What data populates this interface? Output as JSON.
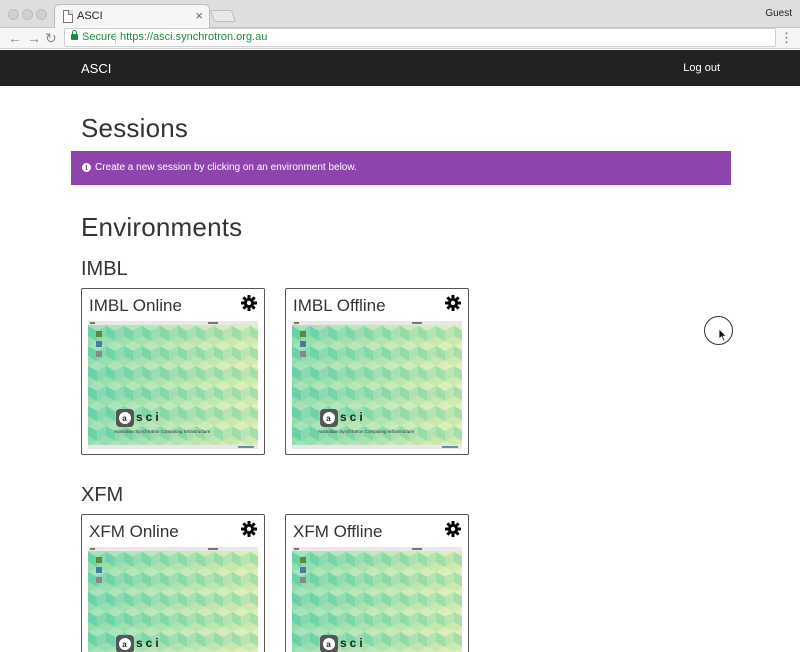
{
  "browser": {
    "tab_title": "ASCI",
    "tab_close": "×",
    "profile": "Guest",
    "back": "←",
    "forward": "→",
    "reload": "↻",
    "secure_label": "Secure",
    "url": "https://asci.synchrotron.org.au",
    "menu": "⋮"
  },
  "navbar": {
    "brand": "ASCI",
    "logout": "Log out"
  },
  "page": {
    "title": "Sessions",
    "alert": "Create a new session by clicking on an environment below.",
    "alert_icon": "i",
    "environments_title": "Environments"
  },
  "groups": [
    {
      "name": "IMBL",
      "cards": [
        {
          "title": "IMBL Online"
        },
        {
          "title": "IMBL Offline"
        }
      ]
    },
    {
      "name": "XFM",
      "cards": [
        {
          "title": "XFM Online"
        },
        {
          "title": "XFM Offline"
        }
      ]
    }
  ],
  "desktop": {
    "logo_letter": "a",
    "logo_text": "sci",
    "tagline": "Australian Synchrotron Computing Infrastructure"
  },
  "colors": {
    "alert": "#8e44ad",
    "navbar": "#222222",
    "secure": "#1f8a3c"
  }
}
